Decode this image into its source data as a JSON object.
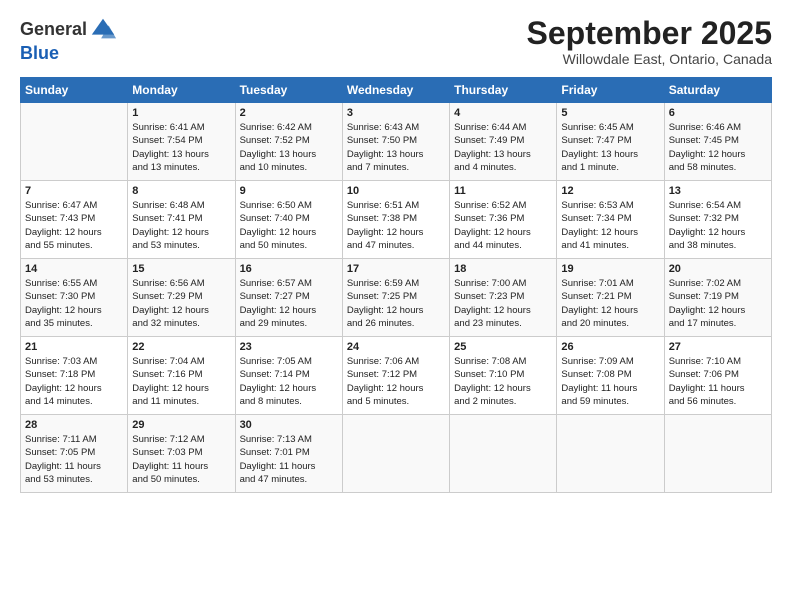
{
  "header": {
    "logo_line1": "General",
    "logo_line2": "Blue",
    "month": "September 2025",
    "location": "Willowdale East, Ontario, Canada"
  },
  "weekdays": [
    "Sunday",
    "Monday",
    "Tuesday",
    "Wednesday",
    "Thursday",
    "Friday",
    "Saturday"
  ],
  "weeks": [
    [
      {
        "day": "",
        "info": ""
      },
      {
        "day": "1",
        "info": "Sunrise: 6:41 AM\nSunset: 7:54 PM\nDaylight: 13 hours\nand 13 minutes."
      },
      {
        "day": "2",
        "info": "Sunrise: 6:42 AM\nSunset: 7:52 PM\nDaylight: 13 hours\nand 10 minutes."
      },
      {
        "day": "3",
        "info": "Sunrise: 6:43 AM\nSunset: 7:50 PM\nDaylight: 13 hours\nand 7 minutes."
      },
      {
        "day": "4",
        "info": "Sunrise: 6:44 AM\nSunset: 7:49 PM\nDaylight: 13 hours\nand 4 minutes."
      },
      {
        "day": "5",
        "info": "Sunrise: 6:45 AM\nSunset: 7:47 PM\nDaylight: 13 hours\nand 1 minute."
      },
      {
        "day": "6",
        "info": "Sunrise: 6:46 AM\nSunset: 7:45 PM\nDaylight: 12 hours\nand 58 minutes."
      }
    ],
    [
      {
        "day": "7",
        "info": "Sunrise: 6:47 AM\nSunset: 7:43 PM\nDaylight: 12 hours\nand 55 minutes."
      },
      {
        "day": "8",
        "info": "Sunrise: 6:48 AM\nSunset: 7:41 PM\nDaylight: 12 hours\nand 53 minutes."
      },
      {
        "day": "9",
        "info": "Sunrise: 6:50 AM\nSunset: 7:40 PM\nDaylight: 12 hours\nand 50 minutes."
      },
      {
        "day": "10",
        "info": "Sunrise: 6:51 AM\nSunset: 7:38 PM\nDaylight: 12 hours\nand 47 minutes."
      },
      {
        "day": "11",
        "info": "Sunrise: 6:52 AM\nSunset: 7:36 PM\nDaylight: 12 hours\nand 44 minutes."
      },
      {
        "day": "12",
        "info": "Sunrise: 6:53 AM\nSunset: 7:34 PM\nDaylight: 12 hours\nand 41 minutes."
      },
      {
        "day": "13",
        "info": "Sunrise: 6:54 AM\nSunset: 7:32 PM\nDaylight: 12 hours\nand 38 minutes."
      }
    ],
    [
      {
        "day": "14",
        "info": "Sunrise: 6:55 AM\nSunset: 7:30 PM\nDaylight: 12 hours\nand 35 minutes."
      },
      {
        "day": "15",
        "info": "Sunrise: 6:56 AM\nSunset: 7:29 PM\nDaylight: 12 hours\nand 32 minutes."
      },
      {
        "day": "16",
        "info": "Sunrise: 6:57 AM\nSunset: 7:27 PM\nDaylight: 12 hours\nand 29 minutes."
      },
      {
        "day": "17",
        "info": "Sunrise: 6:59 AM\nSunset: 7:25 PM\nDaylight: 12 hours\nand 26 minutes."
      },
      {
        "day": "18",
        "info": "Sunrise: 7:00 AM\nSunset: 7:23 PM\nDaylight: 12 hours\nand 23 minutes."
      },
      {
        "day": "19",
        "info": "Sunrise: 7:01 AM\nSunset: 7:21 PM\nDaylight: 12 hours\nand 20 minutes."
      },
      {
        "day": "20",
        "info": "Sunrise: 7:02 AM\nSunset: 7:19 PM\nDaylight: 12 hours\nand 17 minutes."
      }
    ],
    [
      {
        "day": "21",
        "info": "Sunrise: 7:03 AM\nSunset: 7:18 PM\nDaylight: 12 hours\nand 14 minutes."
      },
      {
        "day": "22",
        "info": "Sunrise: 7:04 AM\nSunset: 7:16 PM\nDaylight: 12 hours\nand 11 minutes."
      },
      {
        "day": "23",
        "info": "Sunrise: 7:05 AM\nSunset: 7:14 PM\nDaylight: 12 hours\nand 8 minutes."
      },
      {
        "day": "24",
        "info": "Sunrise: 7:06 AM\nSunset: 7:12 PM\nDaylight: 12 hours\nand 5 minutes."
      },
      {
        "day": "25",
        "info": "Sunrise: 7:08 AM\nSunset: 7:10 PM\nDaylight: 12 hours\nand 2 minutes."
      },
      {
        "day": "26",
        "info": "Sunrise: 7:09 AM\nSunset: 7:08 PM\nDaylight: 11 hours\nand 59 minutes."
      },
      {
        "day": "27",
        "info": "Sunrise: 7:10 AM\nSunset: 7:06 PM\nDaylight: 11 hours\nand 56 minutes."
      }
    ],
    [
      {
        "day": "28",
        "info": "Sunrise: 7:11 AM\nSunset: 7:05 PM\nDaylight: 11 hours\nand 53 minutes."
      },
      {
        "day": "29",
        "info": "Sunrise: 7:12 AM\nSunset: 7:03 PM\nDaylight: 11 hours\nand 50 minutes."
      },
      {
        "day": "30",
        "info": "Sunrise: 7:13 AM\nSunset: 7:01 PM\nDaylight: 11 hours\nand 47 minutes."
      },
      {
        "day": "",
        "info": ""
      },
      {
        "day": "",
        "info": ""
      },
      {
        "day": "",
        "info": ""
      },
      {
        "day": "",
        "info": ""
      }
    ]
  ]
}
